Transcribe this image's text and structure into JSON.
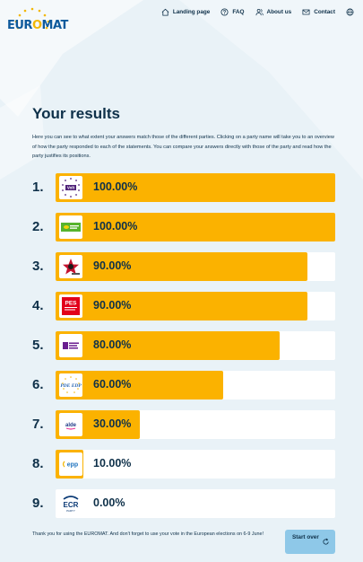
{
  "brand": {
    "logo_text_before": "EUR",
    "logo_text_o": "O",
    "logo_text_after": "MAT"
  },
  "nav": {
    "landing": "Landing page",
    "faq": "FAQ",
    "about": "About us",
    "contact": "Contact",
    "language_icon": "globe-icon"
  },
  "page": {
    "title": "Your results",
    "intro": "Here you can see to what extent your answers match those of the different parties. Clicking on a party name will take you to an overview of how the party responded to each of the statements. You can compare your answers directly with those of the party and read how the party justifies its positions."
  },
  "results": [
    {
      "rank": "1.",
      "party": "Volt",
      "percent_label": "100.00%",
      "match": 100,
      "logo": "volt-logo"
    },
    {
      "rank": "2.",
      "party": "Greens",
      "percent_label": "100.00%",
      "match": 100,
      "logo": "greens-logo"
    },
    {
      "rank": "3.",
      "party": "European Left",
      "percent_label": "90.00%",
      "match": 90,
      "logo": "left-logo"
    },
    {
      "rank": "4.",
      "party": "PES",
      "percent_label": "90.00%",
      "match": 90,
      "logo": "pes-logo"
    },
    {
      "rank": "5.",
      "party": "ALDE / Renew",
      "percent_label": "80.00%",
      "match": 80,
      "logo": "renew-logo"
    },
    {
      "rank": "6.",
      "party": "PDE/EDP",
      "percent_label": "60.00%",
      "match": 60,
      "logo": "edp-logo"
    },
    {
      "rank": "7.",
      "party": "ALDE",
      "percent_label": "30.00%",
      "match": 30,
      "logo": "alde-logo"
    },
    {
      "rank": "8.",
      "party": "EPP",
      "percent_label": "10.00%",
      "match": 10,
      "logo": "epp-logo"
    },
    {
      "rank": "9.",
      "party": "ECR",
      "percent_label": "0.00%",
      "match": 0,
      "logo": "ecr-logo"
    }
  ],
  "logo_texts": {
    "volt": "Volt",
    "pes": "PES",
    "edp": "PDE EDP",
    "alde": "alde",
    "epp": "epp",
    "ecr": "ECR",
    "ecr_sub": "PARTY"
  },
  "footer": {
    "thanks": "Thank you for using the EUROMAT. And don't forget to use your vote in the European elections on 6-9 June!",
    "start_over": "Start over"
  },
  "colors": {
    "accent": "#fbb200",
    "background": "#e9f2f7",
    "text": "#0e3049",
    "button": "#8ec8e8"
  }
}
